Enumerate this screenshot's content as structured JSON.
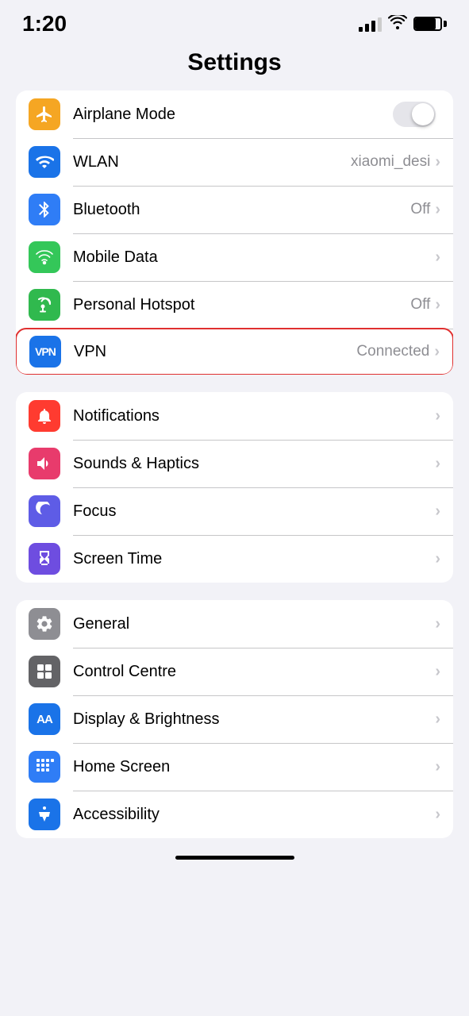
{
  "statusBar": {
    "time": "1:20",
    "battery": 80
  },
  "pageTitle": "Settings",
  "groups": [
    {
      "id": "connectivity",
      "rows": [
        {
          "id": "airplane-mode",
          "icon": "airplane",
          "iconBg": "icon-orange",
          "label": "Airplane Mode",
          "value": "",
          "hasToggle": true,
          "toggleOn": false,
          "selected": false
        },
        {
          "id": "wlan",
          "icon": "wifi",
          "iconBg": "icon-blue",
          "label": "WLAN",
          "value": "xiaomi_desi",
          "hasToggle": false,
          "selected": false
        },
        {
          "id": "bluetooth",
          "icon": "bluetooth",
          "iconBg": "icon-blue2",
          "label": "Bluetooth",
          "value": "Off",
          "hasToggle": false,
          "selected": false
        },
        {
          "id": "mobile-data",
          "icon": "signal",
          "iconBg": "icon-green",
          "label": "Mobile Data",
          "value": "",
          "hasToggle": false,
          "selected": false
        },
        {
          "id": "personal-hotspot",
          "icon": "hotspot",
          "iconBg": "icon-green2",
          "label": "Personal Hotspot",
          "value": "Off",
          "hasToggle": false,
          "selected": false
        },
        {
          "id": "vpn",
          "icon": "vpn",
          "iconBg": "icon-vpn",
          "label": "VPN",
          "value": "Connected",
          "hasToggle": false,
          "selected": true
        }
      ]
    },
    {
      "id": "notifications-group",
      "rows": [
        {
          "id": "notifications",
          "icon": "bell",
          "iconBg": "icon-red",
          "label": "Notifications",
          "value": "",
          "hasToggle": false,
          "selected": false
        },
        {
          "id": "sounds-haptics",
          "icon": "sound",
          "iconBg": "icon-pink",
          "label": "Sounds & Haptics",
          "value": "",
          "hasToggle": false,
          "selected": false
        },
        {
          "id": "focus",
          "icon": "moon",
          "iconBg": "icon-purple",
          "label": "Focus",
          "value": "",
          "hasToggle": false,
          "selected": false
        },
        {
          "id": "screen-time",
          "icon": "hourglass",
          "iconBg": "icon-purple2",
          "label": "Screen Time",
          "value": "",
          "hasToggle": false,
          "selected": false
        }
      ]
    },
    {
      "id": "general-group",
      "rows": [
        {
          "id": "general",
          "icon": "gear",
          "iconBg": "icon-gray",
          "label": "General",
          "value": "",
          "hasToggle": false,
          "selected": false
        },
        {
          "id": "control-centre",
          "icon": "toggles",
          "iconBg": "icon-gray2",
          "label": "Control Centre",
          "value": "",
          "hasToggle": false,
          "selected": false
        },
        {
          "id": "display-brightness",
          "icon": "aa",
          "iconBg": "icon-blue",
          "label": "Display & Brightness",
          "value": "",
          "hasToggle": false,
          "selected": false
        },
        {
          "id": "home-screen",
          "icon": "homescreen",
          "iconBg": "icon-blue2",
          "label": "Home Screen",
          "value": "",
          "hasToggle": false,
          "selected": false
        },
        {
          "id": "accessibility",
          "icon": "accessibility",
          "iconBg": "icon-blue",
          "label": "Accessibility",
          "value": "",
          "hasToggle": false,
          "selected": false
        }
      ]
    }
  ]
}
